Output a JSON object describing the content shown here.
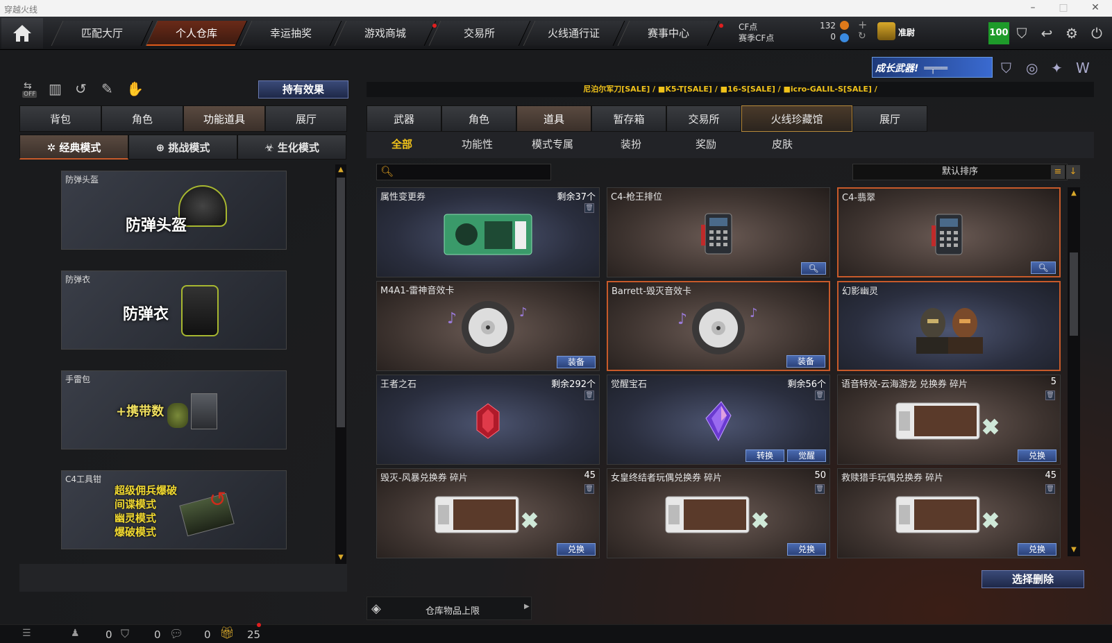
{
  "window": {
    "title": "穿越火线"
  },
  "nav": {
    "items": [
      {
        "label": "匹配大厅"
      },
      {
        "label": "个人仓库"
      },
      {
        "label": "幸运抽奖"
      },
      {
        "label": "游戏商城"
      },
      {
        "label": "交易所"
      },
      {
        "label": "火线通行证"
      },
      {
        "label": "赛事中心"
      }
    ],
    "cf_label": "CF点",
    "cf_value": "132",
    "season_cf_label": "赛季CF点",
    "season_cf_value": "0",
    "rank_text": "准尉",
    "level": "100"
  },
  "left": {
    "toggle_text": "OFF",
    "effects_button": "持有效果",
    "tabs": [
      "背包",
      "角色",
      "功能道具",
      "展厅"
    ],
    "modes": [
      "经典模式",
      "挑战模式",
      "生化模式"
    ],
    "cards": [
      {
        "label": "防弹头盔",
        "big": "防弹头盔"
      },
      {
        "label": "防弹衣",
        "big": "防弹衣"
      },
      {
        "label": "手雷包",
        "big": "+携带数"
      },
      {
        "label": "C4工具钳",
        "lines": [
          "超级佣兵爆破",
          "间谍模式",
          "幽灵模式",
          "爆破模式"
        ]
      }
    ]
  },
  "right": {
    "banner_text": "成长武器!",
    "ticker": "尼泊尔军刀[SALE] / ■K5-T[SALE] / ■16-S[SALE] / ■icro-GALIL-S[SALE] /",
    "tabs": [
      "武器",
      "角色",
      "道具",
      "暂存箱",
      "交易所",
      "火线珍藏馆",
      "展厅"
    ],
    "subtabs": [
      "全部",
      "功能性",
      "模式专属",
      "装扮",
      "奖励",
      "皮肤"
    ],
    "search_placeholder": "",
    "sort_label": "默认排序",
    "items": [
      {
        "name": "属性变更券",
        "remain": "剩余37个",
        "style": "blue",
        "icon": "ticket",
        "trash": true
      },
      {
        "name": "C4-枪王排位",
        "style": "brown",
        "icon": "c4",
        "magnify": true
      },
      {
        "name": "C4-翡翠",
        "style": "brown",
        "icon": "c4",
        "magnify": true,
        "selected": true
      },
      {
        "name": "M4A1-雷神音效卡",
        "style": "brown",
        "icon": "disc",
        "buttons": [
          "装备"
        ]
      },
      {
        "name": "Barrett-毁灭音效卡",
        "style": "brown",
        "icon": "disc",
        "buttons": [
          "装备"
        ],
        "selected": true
      },
      {
        "name": "幻影幽灵",
        "style": "blue",
        "icon": "ghost",
        "selected": true
      },
      {
        "name": "王者之石",
        "remain": "剩余292个",
        "style": "blue",
        "icon": "redgem",
        "trash": true
      },
      {
        "name": "觉醒宝石",
        "remain": "剩余56个",
        "style": "blue",
        "icon": "purplegem",
        "trash": true,
        "buttons": [
          "转换",
          "觉醒"
        ]
      },
      {
        "name": "语音特效-云海游龙 兑换券 碎片",
        "remain": "5",
        "style": "brown",
        "icon": "coupon",
        "trash": true,
        "buttons": [
          "兑换"
        ]
      },
      {
        "name": "毁灭-风暴兑换券 碎片",
        "remain": "45",
        "style": "brown",
        "icon": "coupon",
        "trash": true,
        "buttons": [
          "兑换"
        ]
      },
      {
        "name": "女皇终结者玩偶兑换券 碎片",
        "remain": "50",
        "style": "brown",
        "icon": "coupon",
        "trash": true,
        "buttons": [
          "兑换"
        ]
      },
      {
        "name": "救赎猎手玩偶兑换券 碎片",
        "remain": "45",
        "style": "brown",
        "icon": "coupon",
        "trash": true,
        "buttons": [
          "兑换"
        ]
      }
    ],
    "delete_button": "选择删除",
    "capacity_label": "仓库物品上限"
  },
  "statusbar": {
    "counts": [
      "0",
      "0",
      "0",
      "25"
    ]
  },
  "colors": {
    "accent": "#e05a1a",
    "ticker": "#f0c21a",
    "button_blue": "#2b427a",
    "level_green": "#1e9b2a"
  }
}
